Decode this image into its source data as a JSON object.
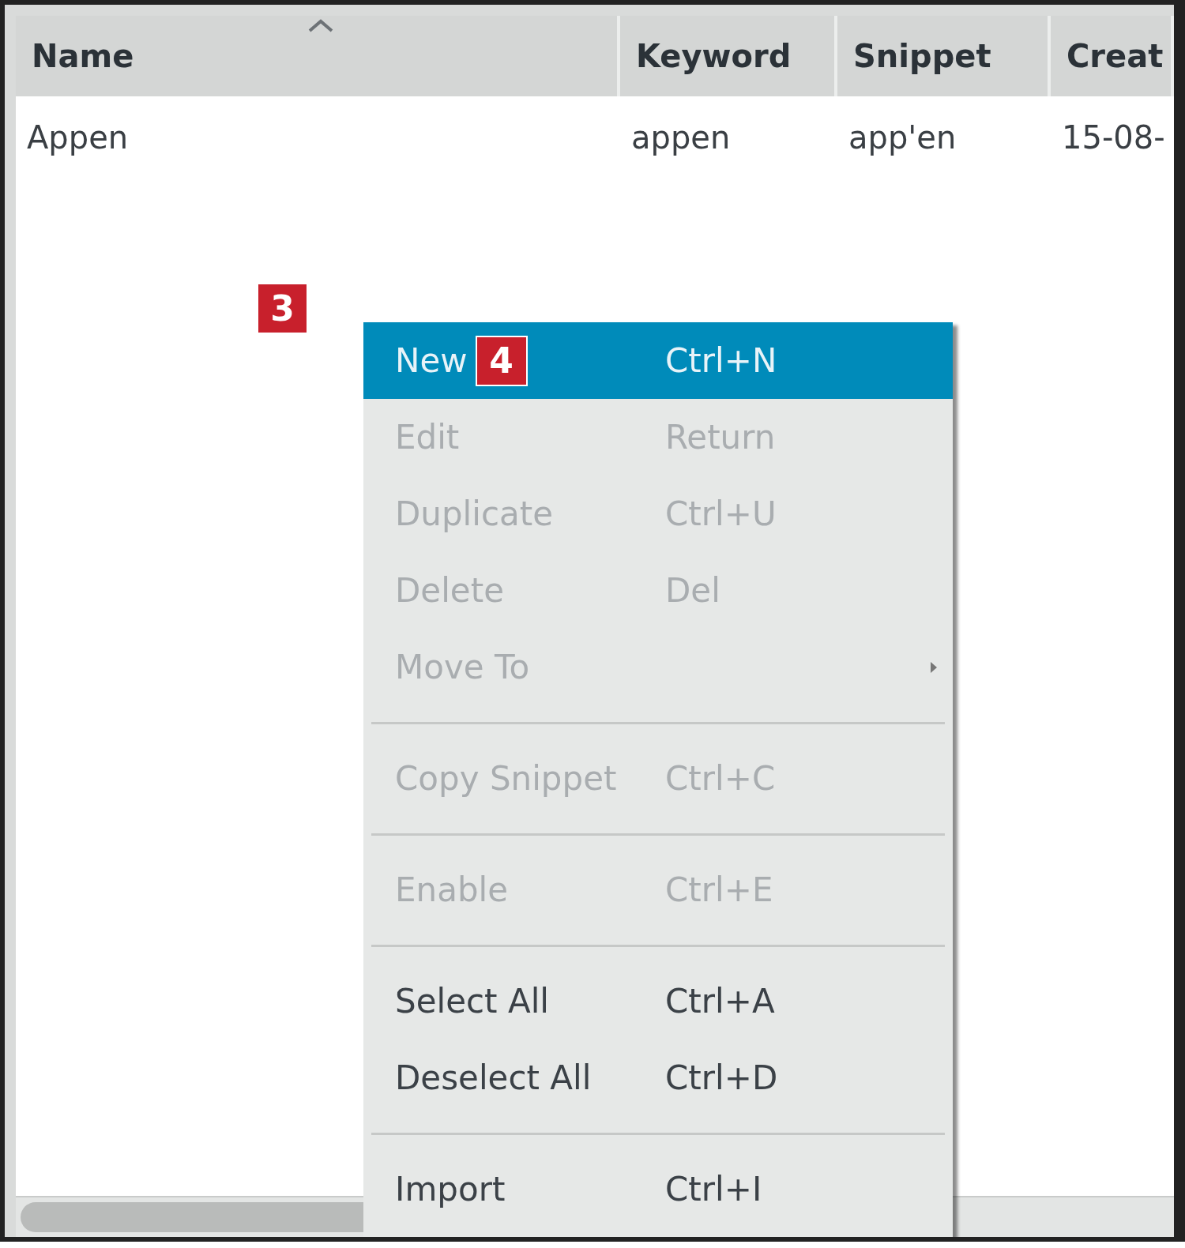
{
  "table": {
    "columns": [
      {
        "label": "Name",
        "sorted": true
      },
      {
        "label": "Keyword",
        "sorted": false
      },
      {
        "label": "Snippet",
        "sorted": false
      },
      {
        "label": "Creat",
        "sorted": false
      }
    ],
    "rows": [
      {
        "cells": [
          "Appen",
          "appen",
          "app'en",
          "15-08-"
        ]
      }
    ]
  },
  "callouts": [
    {
      "label": "3"
    }
  ],
  "context_menu": {
    "items": [
      {
        "kind": "item",
        "label": "New",
        "shortcut": "Ctrl+N",
        "selected": true,
        "disabled": false,
        "callout": "4"
      },
      {
        "kind": "item",
        "label": "Edit",
        "shortcut": "Return",
        "selected": false,
        "disabled": true
      },
      {
        "kind": "item",
        "label": "Duplicate",
        "shortcut": "Ctrl+U",
        "selected": false,
        "disabled": true
      },
      {
        "kind": "item",
        "label": "Delete",
        "shortcut": "Del",
        "selected": false,
        "disabled": true
      },
      {
        "kind": "item",
        "label": "Move To",
        "selected": false,
        "disabled": true,
        "submenu": true
      },
      {
        "kind": "separator"
      },
      {
        "kind": "item",
        "label": "Copy Snippet",
        "shortcut": "Ctrl+C",
        "selected": false,
        "disabled": true
      },
      {
        "kind": "separator"
      },
      {
        "kind": "item",
        "label": "Enable",
        "shortcut": "Ctrl+E",
        "selected": false,
        "disabled": true
      },
      {
        "kind": "separator"
      },
      {
        "kind": "item",
        "label": "Select All",
        "shortcut": "Ctrl+A",
        "selected": false,
        "disabled": false
      },
      {
        "kind": "item",
        "label": "Deselect All",
        "shortcut": "Ctrl+D",
        "selected": false,
        "disabled": false
      },
      {
        "kind": "separator"
      },
      {
        "kind": "item",
        "label": "Import",
        "shortcut": "Ctrl+I",
        "selected": false,
        "disabled": false
      }
    ]
  }
}
